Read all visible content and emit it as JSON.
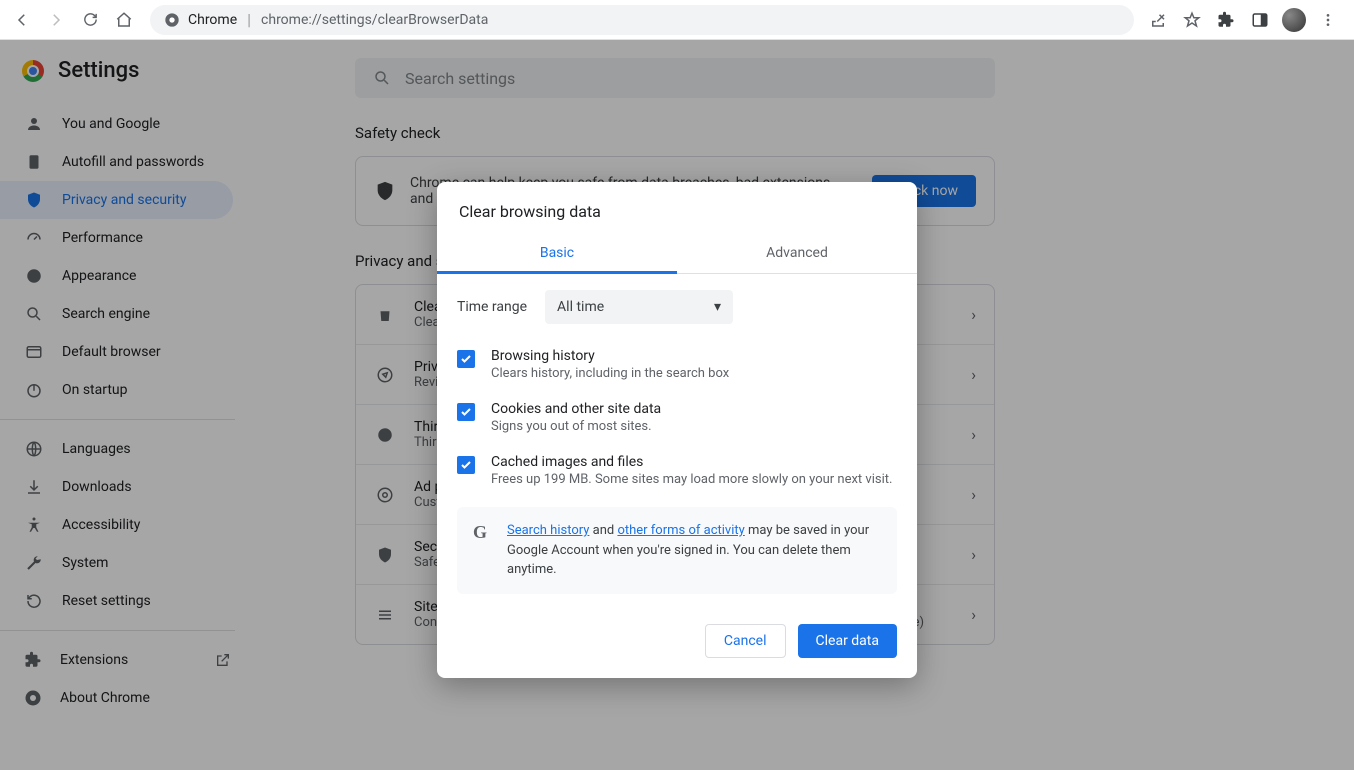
{
  "omnibox": {
    "origin_label": "Chrome",
    "url": "chrome://settings/clearBrowserData"
  },
  "header": {
    "title": "Settings"
  },
  "search": {
    "placeholder": "Search settings"
  },
  "sidebar": {
    "items": [
      {
        "label": "You and Google"
      },
      {
        "label": "Autofill and passwords"
      },
      {
        "label": "Privacy and security"
      },
      {
        "label": "Performance"
      },
      {
        "label": "Appearance"
      },
      {
        "label": "Search engine"
      },
      {
        "label": "Default browser"
      },
      {
        "label": "On startup"
      }
    ],
    "group2": [
      {
        "label": "Languages"
      },
      {
        "label": "Downloads"
      },
      {
        "label": "Accessibility"
      },
      {
        "label": "System"
      },
      {
        "label": "Reset settings"
      }
    ],
    "extensions_label": "Extensions",
    "about_label": "About Chrome"
  },
  "sections": {
    "safety_title": "Safety check",
    "safety_text": "Chrome can help keep you safe from data breaches, bad extensions, and more",
    "safety_button": "Check now",
    "privacy_title": "Privacy and security",
    "rows": [
      {
        "title": "Clear browsing data",
        "sub": "Clear history, cookies, cache, and more"
      },
      {
        "title": "Privacy Guide",
        "sub": "Review key privacy and security controls"
      },
      {
        "title": "Third-party cookies",
        "sub": "Third-party cookies are blocked in Incognito mode"
      },
      {
        "title": "Ad privacy",
        "sub": "Customize the info used by sites to show you ads"
      },
      {
        "title": "Security",
        "sub": "Safe Browsing (protection from dangerous sites) and other security settings"
      },
      {
        "title": "Site settings",
        "sub": "Controls what information sites can use and show (location, camera, pop-ups, and more)"
      }
    ]
  },
  "dialog": {
    "title": "Clear browsing data",
    "tab_basic": "Basic",
    "tab_advanced": "Advanced",
    "time_range_label": "Time range",
    "time_range_value": "All time",
    "options": [
      {
        "title": "Browsing history",
        "sub": "Clears history, including in the search box"
      },
      {
        "title": "Cookies and other site data",
        "sub": "Signs you out of most sites."
      },
      {
        "title": "Cached images and files",
        "sub": "Frees up 199 MB. Some sites may load more slowly on your next visit."
      }
    ],
    "info_link_search": "Search history",
    "info_and": " and ",
    "info_link_other": "other forms of activity",
    "info_rest": " may be saved in your Google Account when you're signed in. You can delete them anytime.",
    "cancel": "Cancel",
    "clear": "Clear data"
  }
}
